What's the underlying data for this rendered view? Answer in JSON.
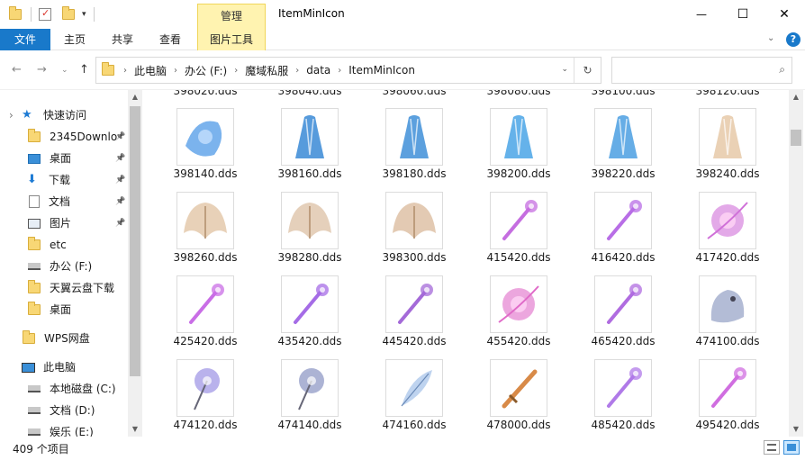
{
  "window": {
    "title": "ItemMinIcon",
    "context_group": "管理",
    "minimize": "—",
    "maximize": "☐",
    "close": "✕"
  },
  "ribbon": {
    "tabs": [
      "文件",
      "主页",
      "共享",
      "查看",
      "图片工具"
    ]
  },
  "address": {
    "back": "←",
    "forward": "→",
    "up": "↑",
    "breadcrumbs": [
      "此电脑",
      "办公 (F:)",
      "魔域私服",
      "data",
      "ItemMinIcon"
    ],
    "search_placeholder": ""
  },
  "nav": {
    "items": [
      {
        "label": "快速访问",
        "icon": "star-icon",
        "pinned": false
      },
      {
        "label": "2345Downlo",
        "icon": "folder-icon",
        "pinned": true
      },
      {
        "label": "桌面",
        "icon": "desktop-icon",
        "pinned": true
      },
      {
        "label": "下载",
        "icon": "download-icon",
        "pinned": true
      },
      {
        "label": "文档",
        "icon": "document-icon",
        "pinned": true
      },
      {
        "label": "图片",
        "icon": "picture-icon",
        "pinned": true
      },
      {
        "label": "etc",
        "icon": "folder-icon",
        "pinned": false
      },
      {
        "label": "办公 (F:)",
        "icon": "drive-icon",
        "pinned": false
      },
      {
        "label": "天翼云盘下载",
        "icon": "folder-icon",
        "pinned": false
      },
      {
        "label": "桌面",
        "icon": "folder-icon",
        "pinned": false
      },
      {
        "label": "WPS网盘",
        "icon": "folder-icon",
        "pinned": false
      },
      {
        "label": "此电脑",
        "icon": "computer-icon",
        "pinned": false
      },
      {
        "label": "本地磁盘 (C:)",
        "icon": "drive-icon",
        "pinned": false
      },
      {
        "label": "文档 (D:)",
        "icon": "drive-icon",
        "pinned": false
      },
      {
        "label": "娱乐 (E:)",
        "icon": "drive-icon",
        "pinned": false
      }
    ]
  },
  "files": {
    "partial_row": [
      "398020.dds",
      "398040.dds",
      "398060.dds",
      "398080.dds",
      "398100.dds",
      "398120.dds"
    ],
    "rows": [
      [
        {
          "name": "398140.dds",
          "kind": "cape",
          "color": "#5aa0e8"
        },
        {
          "name": "398160.dds",
          "kind": "robe",
          "color": "#3a8ad6"
        },
        {
          "name": "398180.dds",
          "kind": "robe",
          "color": "#3f8fd8"
        },
        {
          "name": "398200.dds",
          "kind": "dress",
          "color": "#4aa4e6"
        },
        {
          "name": "398220.dds",
          "kind": "dress",
          "color": "#4b9fe2"
        },
        {
          "name": "398240.dds",
          "kind": "robe",
          "color": "#e6c9a8"
        }
      ],
      [
        {
          "name": "398260.dds",
          "kind": "wings",
          "color": "#e0c2a0"
        },
        {
          "name": "398280.dds",
          "kind": "wings",
          "color": "#dcc0a4"
        },
        {
          "name": "398300.dds",
          "kind": "wings",
          "color": "#d9b89a"
        },
        {
          "name": "415420.dds",
          "kind": "staff",
          "color": "#c56ee0"
        },
        {
          "name": "416420.dds",
          "kind": "staff",
          "color": "#b86ee6"
        },
        {
          "name": "417420.dds",
          "kind": "orb",
          "color": "#d070d8"
        }
      ],
      [
        {
          "name": "425420.dds",
          "kind": "staff",
          "color": "#c96ee6"
        },
        {
          "name": "435420.dds",
          "kind": "staff",
          "color": "#a56ce6"
        },
        {
          "name": "445420.dds",
          "kind": "staff",
          "color": "#a46ad8"
        },
        {
          "name": "455420.dds",
          "kind": "orb",
          "color": "#e06ac8"
        },
        {
          "name": "465420.dds",
          "kind": "staff",
          "color": "#b06ce0"
        },
        {
          "name": "474100.dds",
          "kind": "beast",
          "color": "#9aa6c8"
        }
      ],
      [
        {
          "name": "474120.dds",
          "kind": "flower",
          "color": "#8a7ee0"
        },
        {
          "name": "474140.dds",
          "kind": "flower",
          "color": "#7480b8"
        },
        {
          "name": "474160.dds",
          "kind": "feather",
          "color": "#a8c4ea"
        },
        {
          "name": "478000.dds",
          "kind": "sword",
          "color": "#d88a48"
        },
        {
          "name": "485420.dds",
          "kind": "staff",
          "color": "#b07ae8"
        },
        {
          "name": "495420.dds",
          "kind": "staff",
          "color": "#d06ee0"
        }
      ]
    ]
  },
  "status": {
    "count": "409 个项目"
  }
}
